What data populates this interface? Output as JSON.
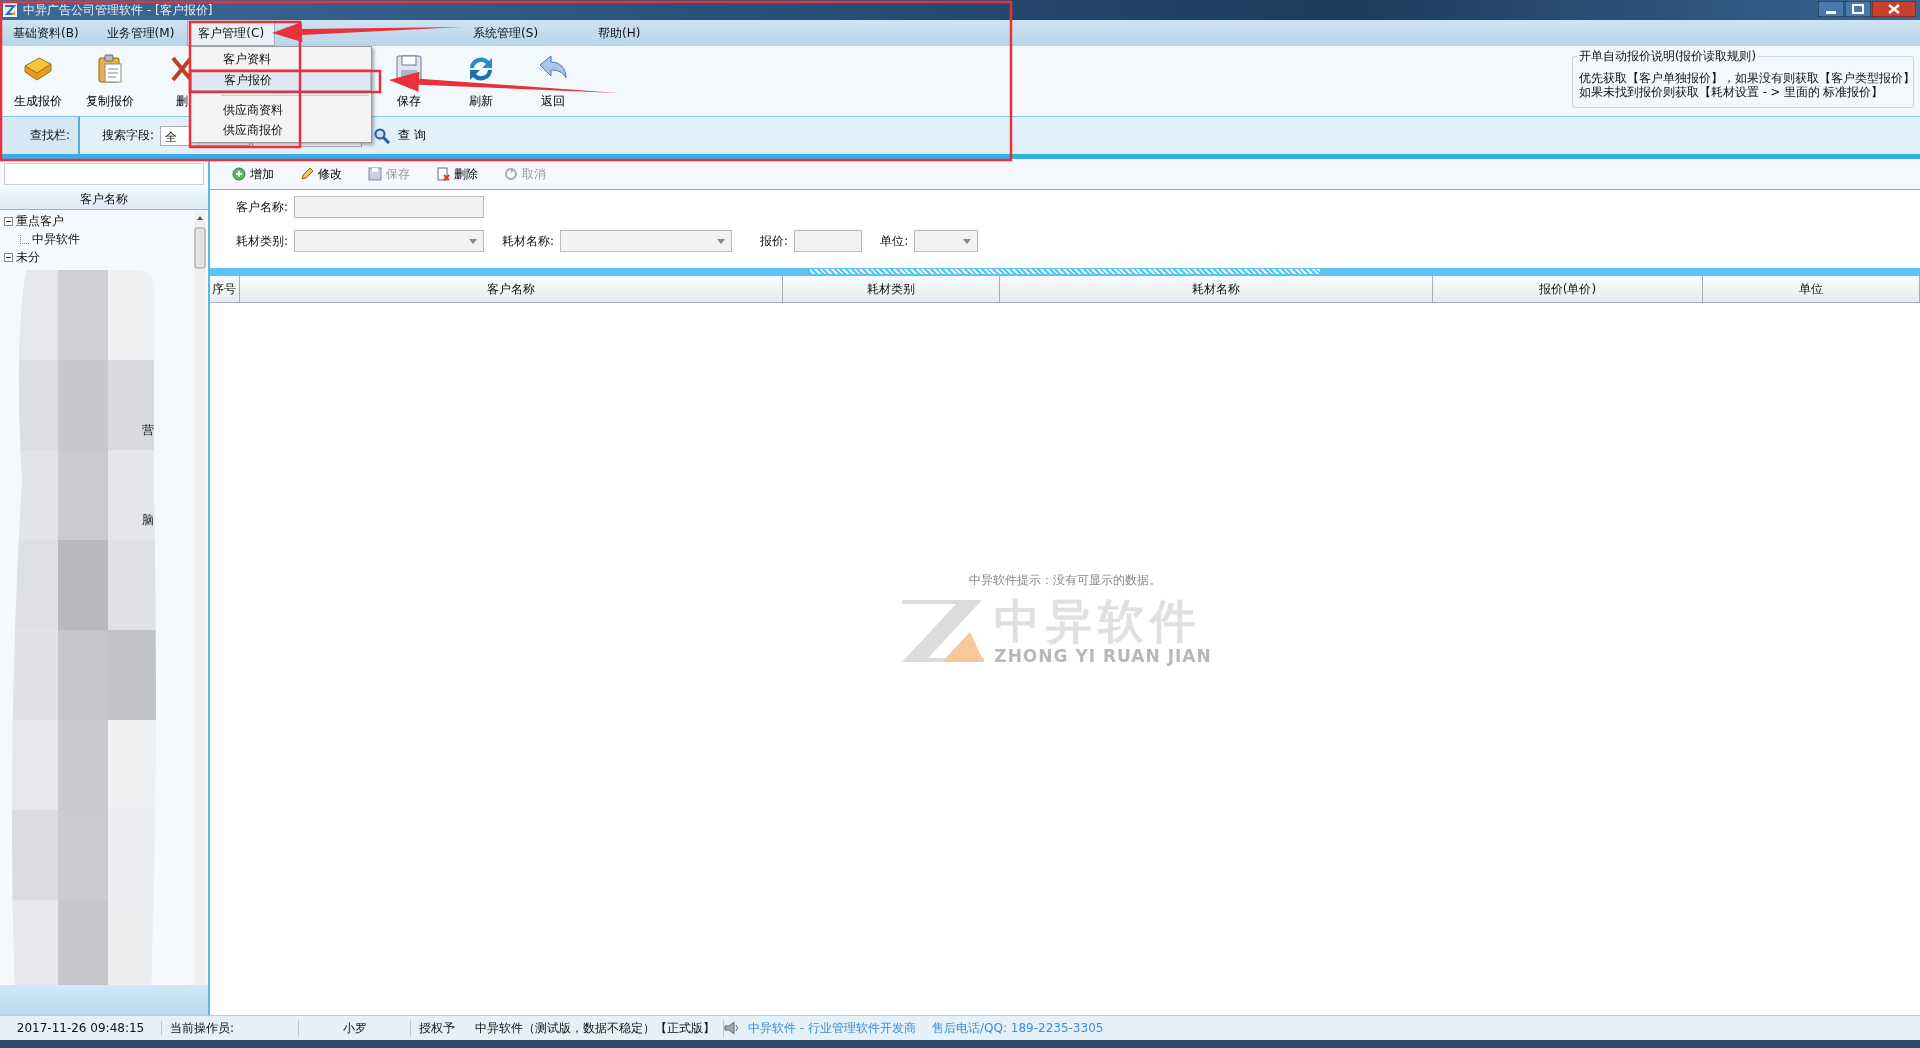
{
  "window": {
    "title": "中异广告公司管理软件 - [客户报价]"
  },
  "menu": [
    {
      "label": "基础资料(B)",
      "selected": false
    },
    {
      "label": "业务管理(M)",
      "selected": false
    },
    {
      "label": "客户管理(C)",
      "selected": true
    },
    {
      "label": "系统管理(S)",
      "selected": false
    },
    {
      "label": "帮助(H)",
      "selected": false
    }
  ],
  "dropdown": [
    {
      "label": "客户资料",
      "selected": false
    },
    {
      "label": "客户报价",
      "selected": true
    },
    {
      "label": "供应商资料",
      "selected": false
    },
    {
      "label": "供应商报价",
      "selected": false
    }
  ],
  "toolbar": [
    {
      "label": "生成报价"
    },
    {
      "label": "复制报价"
    },
    {
      "label": "删"
    },
    {
      "label": "保存"
    },
    {
      "label": "刷新"
    },
    {
      "label": "返回"
    }
  ],
  "info_box": {
    "title": "开单自动报价说明(报价读取规则)",
    "lines": [
      "优先获取【客户单独报价】，如果没有则获取【客户类型报价】",
      "如果未找到报价则获取【耗材设置 - > 里面的 标准报价】"
    ]
  },
  "search_bar": {
    "label": "查找栏:",
    "field_label": "搜索字段:",
    "field_value": "全",
    "button": "查 询"
  },
  "left_panel": {
    "header": "客户名称",
    "tree": [
      {
        "label": "重点客户",
        "expanded": true,
        "children": [
          {
            "label": "中异软件"
          }
        ]
      },
      {
        "label": "未分",
        "expanded": true
      }
    ],
    "fragments": [
      "营",
      "脑"
    ]
  },
  "actions": [
    {
      "label": "增加",
      "disabled": false
    },
    {
      "label": "修改",
      "disabled": false
    },
    {
      "label": "保存",
      "disabled": true
    },
    {
      "label": "删除",
      "disabled": false
    },
    {
      "label": "取消",
      "disabled": true
    }
  ],
  "form": {
    "customer_label": "客户名称:",
    "category_label": "耗材类别:",
    "material_label": "耗材名称:",
    "price_label": "报价:",
    "unit_label": "单位:"
  },
  "table": {
    "columns": [
      "序号",
      "客户名称",
      "耗材类别",
      "耗材名称",
      "报价(单价)",
      "单位"
    ],
    "empty_message": "中异软件提示：没有可显示的数据。"
  },
  "watermark": {
    "title": "中异软件",
    "subtitle": "ZHONG YI RUAN JIAN"
  },
  "status_bar": {
    "datetime": "2017-11-26 09:48:15",
    "operator_label": "当前操作员:",
    "operator": "小罗",
    "license_label": "授权予",
    "license": "中异软件（测试版，数据不稳定）【正式版】",
    "vendor": "中异软件 - 行业管理软件开发商",
    "support": "售后电话/QQ: 189-2235-3305"
  },
  "annotations": [
    {
      "kind": "box"
    },
    {
      "kind": "box"
    },
    {
      "kind": "box"
    },
    {
      "kind": "arrow"
    },
    {
      "kind": "arrow"
    }
  ]
}
